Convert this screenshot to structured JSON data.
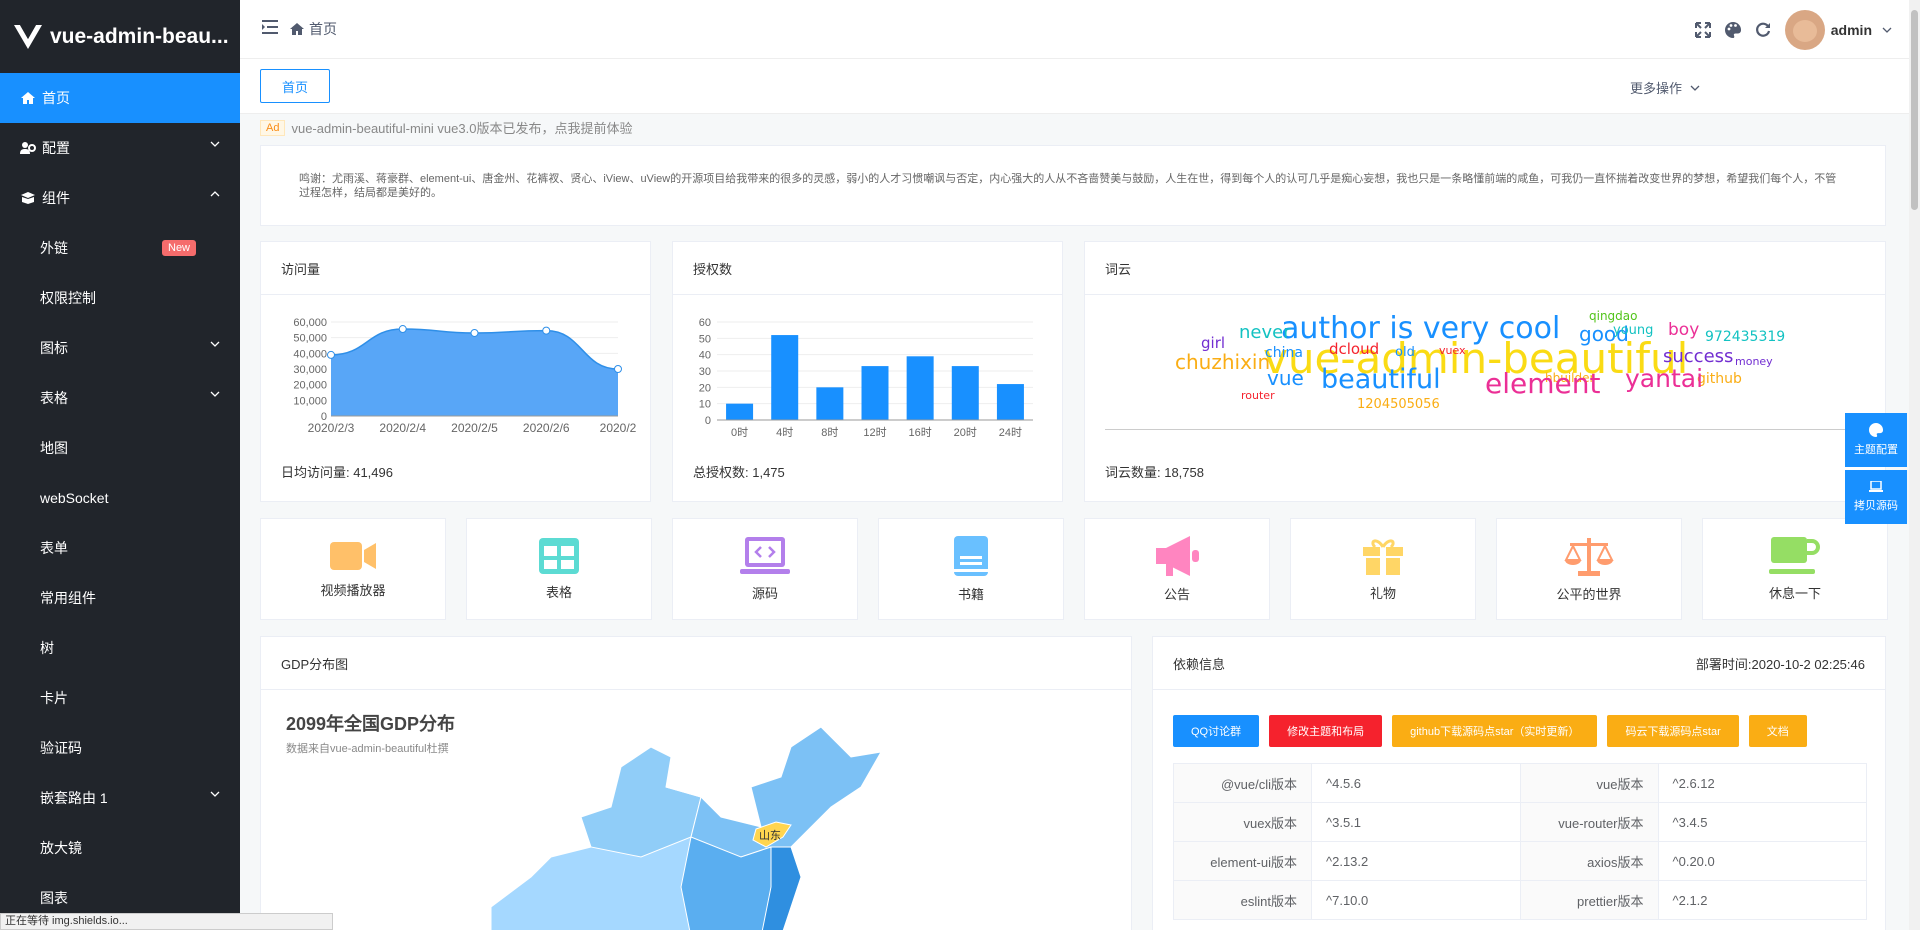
{
  "app": {
    "title": "vue-admin-beau..."
  },
  "sidebar": {
    "items": [
      {
        "label": "首页"
      },
      {
        "label": "配置"
      },
      {
        "label": "组件"
      },
      {
        "label": "外链",
        "badge": "New"
      },
      {
        "label": "权限控制"
      },
      {
        "label": "图标"
      },
      {
        "label": "表格"
      },
      {
        "label": "地图"
      },
      {
        "label": "webSocket"
      },
      {
        "label": "表单"
      },
      {
        "label": "常用组件"
      },
      {
        "label": "树"
      },
      {
        "label": "卡片"
      },
      {
        "label": "验证码"
      },
      {
        "label": "嵌套路由 1"
      },
      {
        "label": "放大镜"
      },
      {
        "label": "图表"
      }
    ]
  },
  "header": {
    "breadcrumb": "首页",
    "username": "admin"
  },
  "tabsbar": {
    "tab": "首页",
    "more": "更多操作"
  },
  "ad": {
    "tag": "Ad",
    "text": "vue-admin-beautiful-mini vue3.0版本已发布，点我提前体验"
  },
  "thanks": "鸣谢：尤雨溪、蒋豪群、element-ui、唐金州、花裤衩、贤心、iView、uView的开源项目给我带来的很多的灵感，弱小的人才习惯嘲讽与否定，内心强大的人从不吝啬赞美与鼓励，人生在世，得到每个人的认可几乎是痴心妄想，我也只是一条略懂前端的咸鱼，可我仍一直怀揣着改变世界的梦想，希望我们每个人，不管过程怎样，结局都是美好的。",
  "visits": {
    "title": "访问量",
    "footer": "日均访问量: 41,496",
    "chart_data": {
      "type": "area",
      "x": [
        "2020/2/3",
        "2020/2/4",
        "2020/2/5",
        "2020/2/6",
        "2020/2"
      ],
      "values": [
        39000,
        55500,
        53000,
        54500,
        30000
      ],
      "yticks": [
        "60,000",
        "50,000",
        "40,000",
        "30,000",
        "20,000",
        "10,000",
        "0"
      ],
      "ylim": [
        0,
        60000
      ],
      "color": "#58a6f7"
    }
  },
  "auth": {
    "title": "授权数",
    "footer": "总授权数: 1,475",
    "chart_data": {
      "type": "bar",
      "categories": [
        "0时",
        "4时",
        "8时",
        "12时",
        "16时",
        "20时",
        "24时"
      ],
      "values": [
        10,
        52,
        20,
        33,
        39,
        33,
        22
      ],
      "yticks": [
        "60",
        "50",
        "40",
        "30",
        "20",
        "10",
        "0"
      ],
      "ylim": [
        0,
        60
      ],
      "color": "#1890ff"
    }
  },
  "cloud": {
    "title": "词云",
    "footer": "词云数量: 18,758",
    "words": [
      {
        "t": "author is very cool",
        "c": "#1890ff"
      },
      {
        "t": "vue-admin-beautiful",
        "c": "#fadb14"
      },
      {
        "t": "qingdao",
        "c": "#52c41a"
      },
      {
        "t": "never",
        "c": "#13c2c2"
      },
      {
        "t": "china",
        "c": "#1890ff"
      },
      {
        "t": "dcloud",
        "c": "#f5222d"
      },
      {
        "t": "old",
        "c": "#1890ff"
      },
      {
        "t": "vuex",
        "c": "#f5222d"
      },
      {
        "t": "good",
        "c": "#1890ff"
      },
      {
        "t": "young",
        "c": "#13c2c2"
      },
      {
        "t": "boy",
        "c": "#eb2f96"
      },
      {
        "t": "972435319",
        "c": "#13c2c2"
      },
      {
        "t": "girl",
        "c": "#722ed1"
      },
      {
        "t": "chuzhixin",
        "c": "#faad14"
      },
      {
        "t": "success",
        "c": "#722ed1"
      },
      {
        "t": "money",
        "c": "#722ed1"
      },
      {
        "t": "vue",
        "c": "#1890ff"
      },
      {
        "t": "beautiful",
        "c": "#1890ff"
      },
      {
        "t": "hbuilder",
        "c": "#faad14"
      },
      {
        "t": "github",
        "c": "#faad14"
      },
      {
        "t": "element",
        "c": "#eb2f96"
      },
      {
        "t": "yantai",
        "c": "#eb2f96"
      },
      {
        "t": "router",
        "c": "#f5222d"
      },
      {
        "t": "1204505056",
        "c": "#faad14"
      }
    ]
  },
  "shortcuts": [
    {
      "label": "视频播放器",
      "icon": "video-icon",
      "color": "#ffc069"
    },
    {
      "label": "表格",
      "icon": "table-icon",
      "color": "#5cdbd3"
    },
    {
      "label": "源码",
      "icon": "laptop-code-icon",
      "color": "#b37feb"
    },
    {
      "label": "书籍",
      "icon": "book-icon",
      "color": "#69c0ff"
    },
    {
      "label": "公告",
      "icon": "bullhorn-icon",
      "color": "#ff85c0"
    },
    {
      "label": "礼物",
      "icon": "gift-icon",
      "color": "#ffd666"
    },
    {
      "label": "公平的世界",
      "icon": "balance-scale-icon",
      "color": "#ff9c6e"
    },
    {
      "label": "休息一下",
      "icon": "coffee-icon",
      "color": "#95de64"
    }
  ],
  "gdp": {
    "card_title": "GDP分布图",
    "map_title": "2099年全国GDP分布",
    "map_subtitle": "数据来自vue-admin-beautiful杜撰",
    "highlight": "山东"
  },
  "deps": {
    "title": "依赖信息",
    "deploy_time": "部署时间:2020-10-2 02:25:46",
    "buttons": [
      {
        "label": "QQ讨论群",
        "color": "#1890ff"
      },
      {
        "label": "修改主题和布局",
        "color": "#f5222d"
      },
      {
        "label": "github下载源码点star（实时更新）",
        "color": "#faad14"
      },
      {
        "label": "码云下载源码点star",
        "color": "#faad14"
      },
      {
        "label": "文档",
        "color": "#faad14"
      }
    ],
    "rows": [
      [
        "@vue/cli版本",
        "^4.5.6",
        "vue版本",
        "^2.6.12"
      ],
      [
        "vuex版本",
        "^3.5.1",
        "vue-router版本",
        "^3.4.5"
      ],
      [
        "element-ui版本",
        "^2.13.2",
        "axios版本",
        "^0.20.0"
      ],
      [
        "eslint版本",
        "^7.10.0",
        "prettier版本",
        "^2.1.2"
      ]
    ]
  },
  "float": {
    "theme": "主题配置",
    "copy": "拷贝源码"
  },
  "status": "正在等待 img.shields.io..."
}
